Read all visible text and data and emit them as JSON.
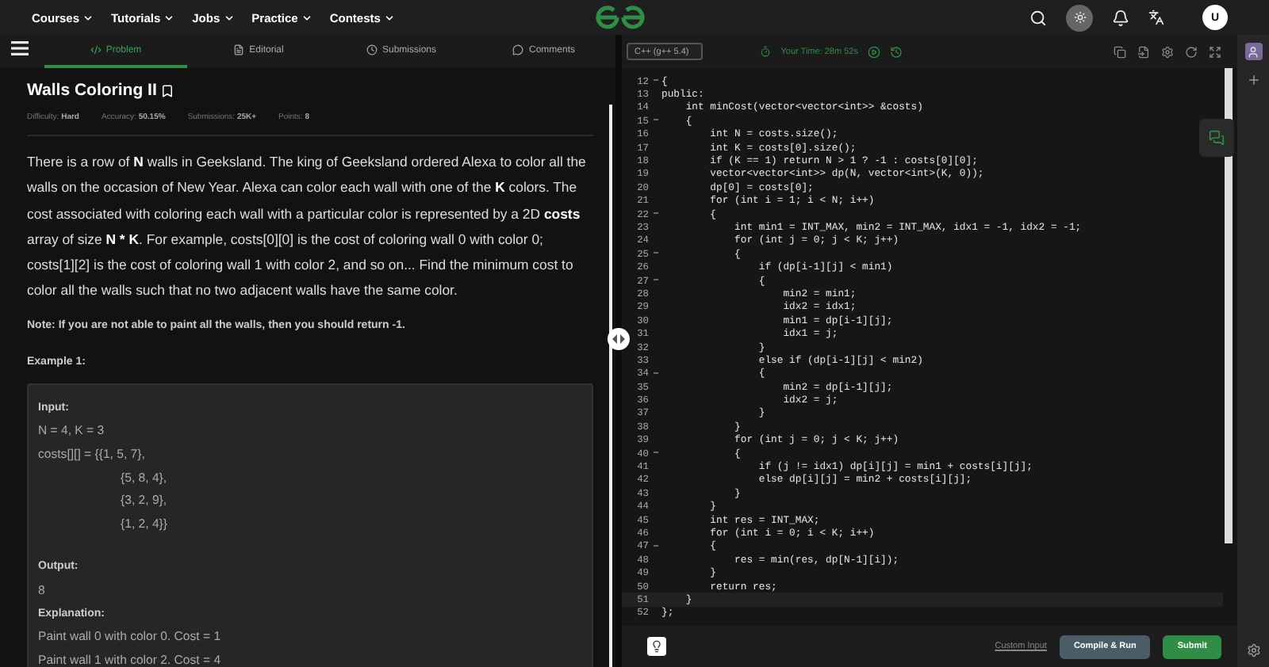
{
  "nav": {
    "items": [
      "Courses",
      "Tutorials",
      "Jobs",
      "Practice",
      "Contests"
    ],
    "avatar": "U"
  },
  "tabs": [
    {
      "label": "Problem",
      "selected": true
    },
    {
      "label": "Editorial",
      "selected": false
    },
    {
      "label": "Submissions",
      "selected": false
    },
    {
      "label": "Comments",
      "selected": false
    }
  ],
  "problem": {
    "title": "Walls Coloring II",
    "meta": [
      {
        "label": "Difficulty:",
        "value": "Hard"
      },
      {
        "label": "Accuracy:",
        "value": "50.15%"
      },
      {
        "label": "Submissions:",
        "value": "25K+"
      },
      {
        "label": "Points:",
        "value": "8"
      }
    ],
    "description": "There is a row of **N** walls in Geeksland. The king of Geeksland ordered Alexa to color all the walls on the occasion of New Year. Alexa can color each wall with one of the **K** colors. The cost associated with coloring each wall with a particular color is represented by a 2D **costs** array of size **N * K**. For example, costs[0][0] is the cost of coloring wall 0 with color 0; costs[1][2] is the cost of coloring wall 1 with color 2, and so on... Find the minimum cost to color all the walls such that no two adjacent walls have the same color.",
    "note": "Note: If you are not able to paint all the walls, then you should return -1.",
    "example_title": "Example 1:",
    "example": [
      {
        "kind": "label",
        "text": "Input:"
      },
      {
        "kind": "text",
        "text": "N = 4, K = 3"
      },
      {
        "kind": "text",
        "text": "costs[][] = {{1, 5, 7},"
      },
      {
        "kind": "cont",
        "text": "{5, 8, 4},"
      },
      {
        "kind": "cont",
        "text": "{3, 2, 9},"
      },
      {
        "kind": "cont",
        "text": "{1, 2, 4}}"
      },
      {
        "kind": "gap_label",
        "text": "Output:"
      },
      {
        "kind": "text",
        "text": "8"
      },
      {
        "kind": "label",
        "text": "Explanation:"
      },
      {
        "kind": "text",
        "text": "Paint wall 0 with color 0. Cost = 1"
      },
      {
        "kind": "text",
        "text": "Paint wall 1 with color 2. Cost = 4"
      }
    ]
  },
  "editor": {
    "language": "C++ (g++ 5.4)",
    "timer": "Your Time: 28m 52s",
    "lines": [
      {
        "n": "12",
        "code": "{",
        "fold": true,
        "current": false
      },
      {
        "n": "13",
        "code": "public:",
        "fold": false,
        "current": false
      },
      {
        "n": "14",
        "code": "    int minCost(vector<vector<int>> &costs)",
        "fold": false,
        "current": false
      },
      {
        "n": "15",
        "code": "    {",
        "fold": true,
        "current": false
      },
      {
        "n": "16",
        "code": "        int N = costs.size();",
        "fold": false,
        "current": false
      },
      {
        "n": "17",
        "code": "        int K = costs[0].size();",
        "fold": false,
        "current": false
      },
      {
        "n": "18",
        "code": "        if (K == 1) return N > 1 ? -1 : costs[0][0];",
        "fold": false,
        "current": false
      },
      {
        "n": "19",
        "code": "        vector<vector<int>> dp(N, vector<int>(K, 0));",
        "fold": false,
        "current": false
      },
      {
        "n": "20",
        "code": "        dp[0] = costs[0];",
        "fold": false,
        "current": false
      },
      {
        "n": "21",
        "code": "        for (int i = 1; i < N; i++)",
        "fold": false,
        "current": false
      },
      {
        "n": "22",
        "code": "        {",
        "fold": true,
        "current": false
      },
      {
        "n": "23",
        "code": "            int min1 = INT_MAX, min2 = INT_MAX, idx1 = -1, idx2 = -1;",
        "fold": false,
        "current": false
      },
      {
        "n": "24",
        "code": "            for (int j = 0; j < K; j++)",
        "fold": false,
        "current": false
      },
      {
        "n": "25",
        "code": "            {",
        "fold": true,
        "current": false
      },
      {
        "n": "26",
        "code": "                if (dp[i-1][j] < min1)",
        "fold": false,
        "current": false
      },
      {
        "n": "27",
        "code": "                {",
        "fold": true,
        "current": false
      },
      {
        "n": "28",
        "code": "                    min2 = min1;",
        "fold": false,
        "current": false
      },
      {
        "n": "29",
        "code": "                    idx2 = idx1;",
        "fold": false,
        "current": false
      },
      {
        "n": "30",
        "code": "                    min1 = dp[i-1][j];",
        "fold": false,
        "current": false
      },
      {
        "n": "31",
        "code": "                    idx1 = j;",
        "fold": false,
        "current": false
      },
      {
        "n": "32",
        "code": "                }",
        "fold": false,
        "current": false
      },
      {
        "n": "33",
        "code": "                else if (dp[i-1][j] < min2)",
        "fold": false,
        "current": false
      },
      {
        "n": "34",
        "code": "                {",
        "fold": true,
        "current": false
      },
      {
        "n": "35",
        "code": "                    min2 = dp[i-1][j];",
        "fold": false,
        "current": false
      },
      {
        "n": "36",
        "code": "                    idx2 = j;",
        "fold": false,
        "current": false
      },
      {
        "n": "37",
        "code": "                }",
        "fold": false,
        "current": false
      },
      {
        "n": "38",
        "code": "            }",
        "fold": false,
        "current": false
      },
      {
        "n": "39",
        "code": "            for (int j = 0; j < K; j++)",
        "fold": false,
        "current": false
      },
      {
        "n": "40",
        "code": "            {",
        "fold": true,
        "current": false
      },
      {
        "n": "41",
        "code": "                if (j != idx1) dp[i][j] = min1 + costs[i][j];",
        "fold": false,
        "current": false
      },
      {
        "n": "42",
        "code": "                else dp[i][j] = min2 + costs[i][j];",
        "fold": false,
        "current": false
      },
      {
        "n": "43",
        "code": "            }",
        "fold": false,
        "current": false
      },
      {
        "n": "44",
        "code": "        }",
        "fold": false,
        "current": false
      },
      {
        "n": "45",
        "code": "        int res = INT_MAX;",
        "fold": false,
        "current": false
      },
      {
        "n": "46",
        "code": "        for (int i = 0; i < K; i++)",
        "fold": false,
        "current": false
      },
      {
        "n": "47",
        "code": "        {",
        "fold": true,
        "current": false
      },
      {
        "n": "48",
        "code": "            res = min(res, dp[N-1][i]);",
        "fold": false,
        "current": false
      },
      {
        "n": "49",
        "code": "        }",
        "fold": false,
        "current": false
      },
      {
        "n": "50",
        "code": "        return res;",
        "fold": false,
        "current": false
      },
      {
        "n": "51",
        "code": "    }",
        "fold": false,
        "current": true
      },
      {
        "n": "52",
        "code": "};",
        "fold": false,
        "current": false
      }
    ],
    "custom_input": "Custom Input",
    "compile": "Compile & Run",
    "submit": "Submit"
  }
}
